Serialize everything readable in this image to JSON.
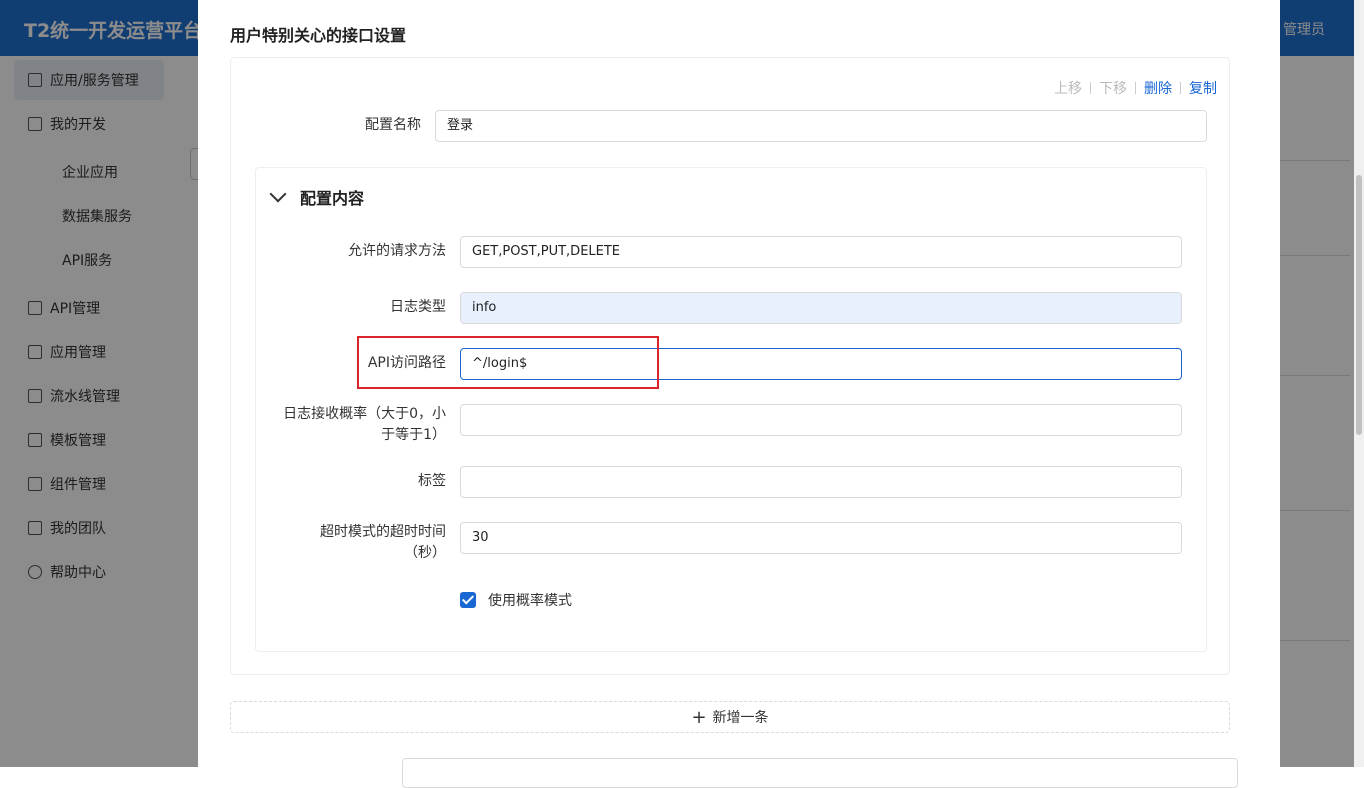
{
  "app": {
    "title": "T2统一开发运营平台",
    "user": "管理员"
  },
  "sidebar": {
    "items": [
      {
        "label": "应用/服务管理",
        "icon": "grid-icon"
      },
      {
        "label": "我的开发",
        "icon": "board-icon"
      },
      {
        "label": "API管理",
        "icon": "api-icon"
      },
      {
        "label": "应用管理",
        "icon": "apps-icon"
      },
      {
        "label": "流水线管理",
        "icon": "pipeline-icon"
      },
      {
        "label": "模板管理",
        "icon": "template-icon"
      },
      {
        "label": "组件管理",
        "icon": "component-icon"
      },
      {
        "label": "我的团队",
        "icon": "team-icon"
      },
      {
        "label": "帮助中心",
        "icon": "help-icon"
      }
    ],
    "sub_items": [
      {
        "label": "企业应用"
      },
      {
        "label": "数据集服务"
      },
      {
        "label": "API服务"
      }
    ]
  },
  "modal": {
    "title": "用户特别关心的接口设置",
    "actions": {
      "up": "上移",
      "down": "下移",
      "delete": "删除",
      "copy": "复制"
    },
    "config_name": {
      "label": "配置名称",
      "value": "登录"
    },
    "section": {
      "title": "配置内容",
      "fields": {
        "methods": {
          "label": "允许的请求方法",
          "value": "GET,POST,PUT,DELETE"
        },
        "log_type": {
          "label": "日志类型",
          "value": "info"
        },
        "api_path": {
          "label": "API访问路径",
          "value": "^/login$"
        },
        "log_rate": {
          "label_line1": "日志接收概率（大于0，小",
          "label_line2": "于等于1）",
          "value": ""
        },
        "tags": {
          "label": "标签",
          "value": ""
        },
        "timeout": {
          "label_line1": "超时模式的超时时间",
          "label_line2": "（秒）",
          "value": "30"
        }
      },
      "checkbox": {
        "label": "使用概率模式",
        "checked": true
      }
    },
    "add_button": "新增一条"
  },
  "colors": {
    "primary": "#1967d2",
    "highlight": "#d9252b",
    "topbar": "#1e6fd0"
  }
}
